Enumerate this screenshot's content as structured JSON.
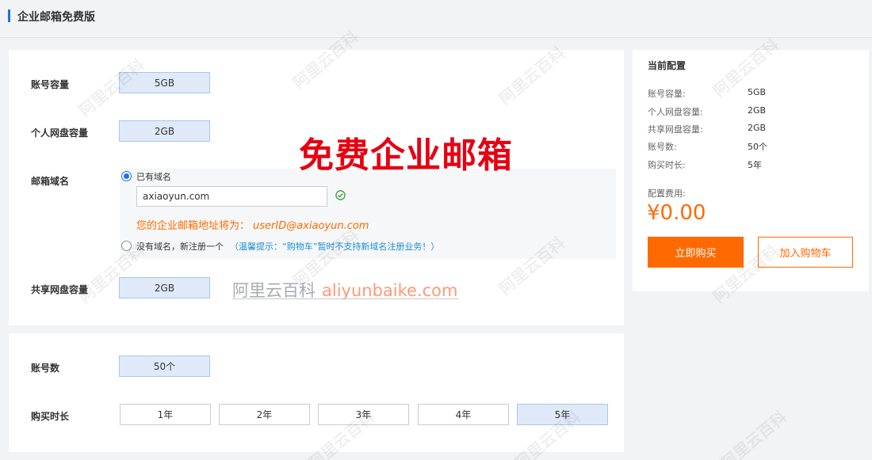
{
  "header": {
    "title": "企业邮箱免费版"
  },
  "main": {
    "account_capacity": {
      "label": "账号容量",
      "value": "5GB"
    },
    "personal_disk": {
      "label": "个人网盘容量",
      "value": "2GB"
    },
    "domain": {
      "label": "邮箱域名",
      "has_domain_label": "已有域名",
      "domain_value": "axiaoyun.com",
      "address_prefix": "您的企业邮箱地址将为：",
      "address_value": "userID@axiaoyun.com",
      "no_domain_label": "没有域名，新注册一个",
      "hint": "（温馨提示：“购物车”暂时不支持新域名注册业务！）"
    },
    "shared_disk": {
      "label": "共享网盘容量",
      "value": "2GB"
    },
    "overlay_title": "免费企业邮箱",
    "watermark": {
      "cn": "阿里云百科",
      "site": "aliyunbaike.com"
    }
  },
  "account": {
    "count": {
      "label": "账号数",
      "value": "50个"
    },
    "duration": {
      "label": "购买时长",
      "options": [
        "1年",
        "2年",
        "3年",
        "4年",
        "5年"
      ],
      "selected": "5年"
    }
  },
  "summary": {
    "title": "当前配置",
    "rows": [
      {
        "k": "账号容量:",
        "v": "5GB"
      },
      {
        "k": "个人网盘容量:",
        "v": "2GB"
      },
      {
        "k": "共享网盘容量:",
        "v": "2GB"
      },
      {
        "k": "账号数:",
        "v": "50个"
      },
      {
        "k": "购买时长:",
        "v": "5年"
      }
    ],
    "fee_label": "配置费用:",
    "fee": "¥0.00",
    "buy_label": "立即购买",
    "cart_label": "加入购物车"
  },
  "background_watermark": "阿里云百科",
  "colors": {
    "accent": "#1a73e8",
    "orange": "#ff6a00",
    "red": "#e60012",
    "chip_bg": "#dfe9f8"
  }
}
